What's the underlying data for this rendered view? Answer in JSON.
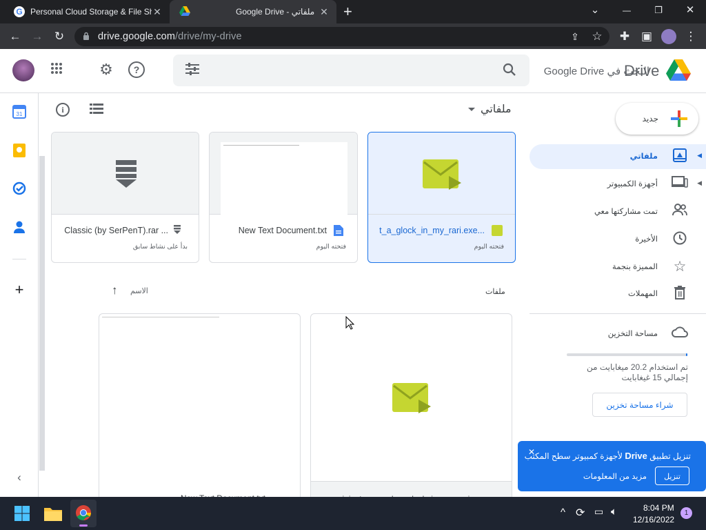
{
  "browser": {
    "tabs": [
      {
        "title": "Personal Cloud Storage & File Sh",
        "close": "✕"
      },
      {
        "title": "Google Drive - ملفاتي",
        "close": "✕"
      }
    ],
    "new_tab": "+",
    "window_controls": {
      "dropdown": "⌄",
      "minimize": "—",
      "restore": "❐",
      "close": "✕"
    },
    "url_host": "drive.google.com",
    "url_path": "/drive/my-drive"
  },
  "drive": {
    "logo_text": "Drive",
    "search_placeholder": "البحث في Google Drive",
    "new_button": "جديد",
    "breadcrumb": "ملفاتي",
    "nav": [
      {
        "label": "ملفاتي",
        "icon": "my-drive-icon",
        "active": true,
        "arrow": "◀"
      },
      {
        "label": "أجهزة الكمبيوتر",
        "icon": "computer-icon",
        "active": false,
        "arrow": "◀"
      },
      {
        "label": "تمت مشاركتها معي",
        "icon": "shared-icon",
        "active": false
      },
      {
        "label": "الأخيرة",
        "icon": "clock-icon",
        "active": false
      },
      {
        "label": "المميزة بنجمة",
        "icon": "star-icon",
        "active": false
      },
      {
        "label": "المهملات",
        "icon": "trash-icon",
        "active": false
      }
    ],
    "storage": {
      "label": "مساحة التخزين",
      "usage_text": "تم استخدام 20.2 ميغابايت من إجمالي 15 غيغابايت",
      "buy_button": "شراء مساحة تخزين",
      "used_fraction": 0.0013
    },
    "suggested_cards": [
      {
        "name": "t_a_glock_in_my_rari.exe...",
        "sub": "فتحته اليوم",
        "selected": true
      },
      {
        "name": "New Text Document.txt",
        "sub": "فتحته اليوم",
        "selected": false
      },
      {
        "name": "Classic (by SerPenT).rar ...",
        "sub": "بدأ على نشاط سابق",
        "selected": false
      }
    ],
    "files_section": "ملفات",
    "sort_label": "الاسم",
    "sort_arrow": "↑",
    "bottom_files": [
      {
        "name": "New Text Document.txt"
      },
      {
        "name": "i_just_copped_a_glock_in_my_rari.exe"
      }
    ],
    "toast": {
      "text_before": "تنزيل تطبيق",
      "text_brand": "Drive",
      "text_after": "لأجهزة كمبيوتر سطح المكتب",
      "download_button": "تنزيل",
      "more_info": "مزيد من المعلومات",
      "close": "✕"
    },
    "colors": {
      "accent": "#1a73e8",
      "selected_bg": "#e8f0fe",
      "exe_icon": "#c5d631"
    }
  },
  "taskbar": {
    "time": "8:04 PM",
    "date": "12/16/2022",
    "notification_count": "1",
    "chevron": "^"
  }
}
